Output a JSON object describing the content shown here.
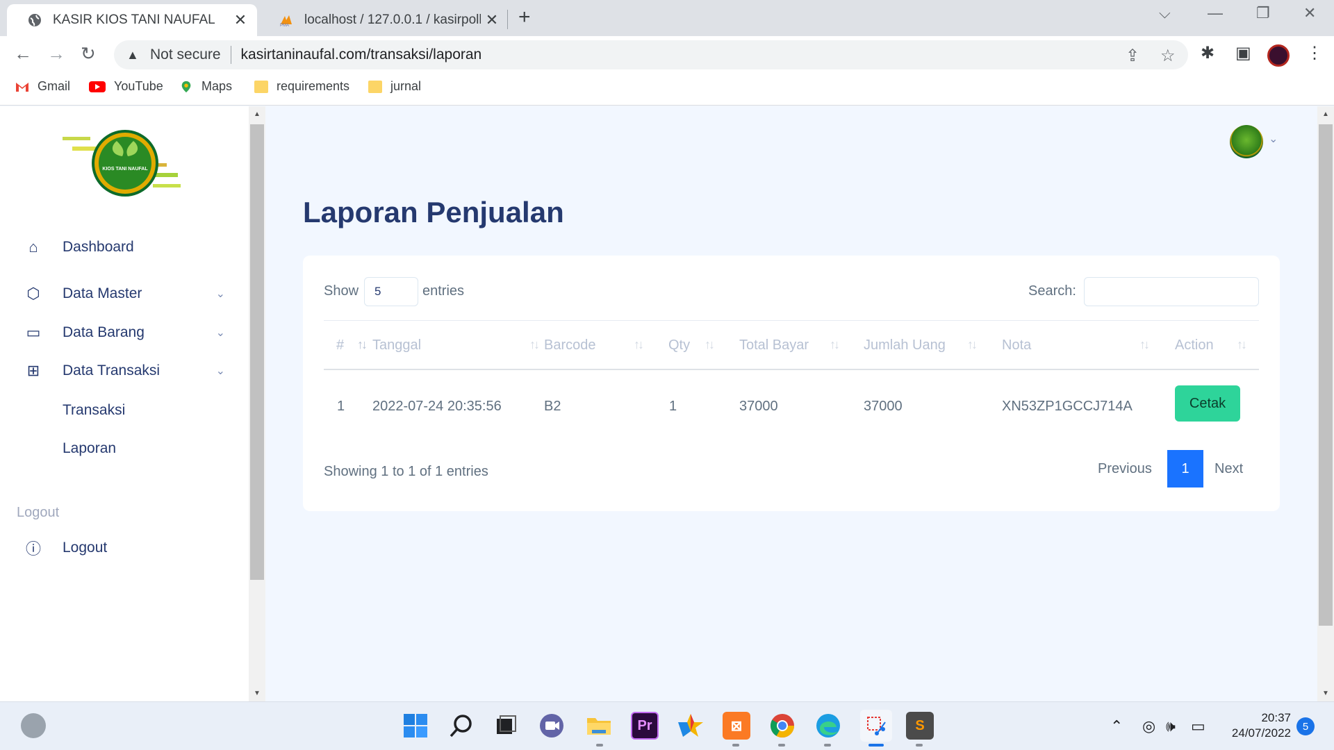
{
  "browser": {
    "tabs": [
      {
        "title": "KASIR KIOS TANI NAUFAL",
        "active": true
      },
      {
        "title": "localhost / 127.0.0.1 / kasirpolkam",
        "active": false
      }
    ],
    "address": {
      "security": "Not secure",
      "url": "kasirtaninaufal.com/transaksi/laporan"
    },
    "bookmarks": [
      "Gmail",
      "YouTube",
      "Maps",
      "requirements",
      "jurnal"
    ]
  },
  "sidebar": {
    "logo_text": "KIOS TANI NAUFAL",
    "items": [
      {
        "label": "Dashboard",
        "icon": "house-icon"
      },
      {
        "label": "Data Master",
        "icon": "box-icon"
      },
      {
        "label": "Data Barang",
        "icon": "card-icon"
      },
      {
        "label": "Data Transaksi",
        "icon": "grid-icon"
      }
    ],
    "subitems": [
      "Transaksi",
      "Laporan"
    ],
    "section_title": "Logout",
    "logout": "Logout"
  },
  "page": {
    "title": "Laporan Penjualan",
    "show_label": "Show",
    "entries_value": "5",
    "entries_label": "entries",
    "search_label": "Search:",
    "columns": [
      "#",
      "Tanggal",
      "Barcode",
      "Qty",
      "Total Bayar",
      "Jumlah Uang",
      "Nota",
      "Action"
    ],
    "rows": [
      {
        "no": "1",
        "tanggal": "2022-07-24 20:35:56",
        "barcode": "B2",
        "qty": "1",
        "total_bayar": "37000",
        "jumlah_uang": "37000",
        "nota": "XN53ZP1GCCJ714A",
        "action": "Cetak"
      }
    ],
    "info": "Showing 1 to 1 of 1 entries",
    "pagination": {
      "previous": "Previous",
      "current": "1",
      "next": "Next"
    }
  },
  "taskbar": {
    "time": "20:37",
    "date": "24/07/2022",
    "notifications": "5"
  }
}
